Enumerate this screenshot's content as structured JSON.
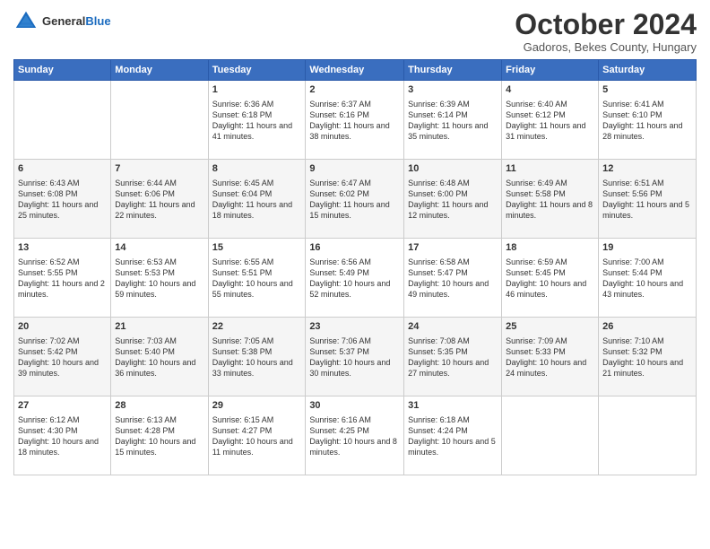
{
  "header": {
    "logo_general": "General",
    "logo_blue": "Blue",
    "month": "October 2024",
    "location": "Gadoros, Bekes County, Hungary"
  },
  "days_of_week": [
    "Sunday",
    "Monday",
    "Tuesday",
    "Wednesday",
    "Thursday",
    "Friday",
    "Saturday"
  ],
  "weeks": [
    [
      {
        "day": "",
        "info": ""
      },
      {
        "day": "",
        "info": ""
      },
      {
        "day": "1",
        "info": "Sunrise: 6:36 AM\nSunset: 6:18 PM\nDaylight: 11 hours and 41 minutes."
      },
      {
        "day": "2",
        "info": "Sunrise: 6:37 AM\nSunset: 6:16 PM\nDaylight: 11 hours and 38 minutes."
      },
      {
        "day": "3",
        "info": "Sunrise: 6:39 AM\nSunset: 6:14 PM\nDaylight: 11 hours and 35 minutes."
      },
      {
        "day": "4",
        "info": "Sunrise: 6:40 AM\nSunset: 6:12 PM\nDaylight: 11 hours and 31 minutes."
      },
      {
        "day": "5",
        "info": "Sunrise: 6:41 AM\nSunset: 6:10 PM\nDaylight: 11 hours and 28 minutes."
      }
    ],
    [
      {
        "day": "6",
        "info": "Sunrise: 6:43 AM\nSunset: 6:08 PM\nDaylight: 11 hours and 25 minutes."
      },
      {
        "day": "7",
        "info": "Sunrise: 6:44 AM\nSunset: 6:06 PM\nDaylight: 11 hours and 22 minutes."
      },
      {
        "day": "8",
        "info": "Sunrise: 6:45 AM\nSunset: 6:04 PM\nDaylight: 11 hours and 18 minutes."
      },
      {
        "day": "9",
        "info": "Sunrise: 6:47 AM\nSunset: 6:02 PM\nDaylight: 11 hours and 15 minutes."
      },
      {
        "day": "10",
        "info": "Sunrise: 6:48 AM\nSunset: 6:00 PM\nDaylight: 11 hours and 12 minutes."
      },
      {
        "day": "11",
        "info": "Sunrise: 6:49 AM\nSunset: 5:58 PM\nDaylight: 11 hours and 8 minutes."
      },
      {
        "day": "12",
        "info": "Sunrise: 6:51 AM\nSunset: 5:56 PM\nDaylight: 11 hours and 5 minutes."
      }
    ],
    [
      {
        "day": "13",
        "info": "Sunrise: 6:52 AM\nSunset: 5:55 PM\nDaylight: 11 hours and 2 minutes."
      },
      {
        "day": "14",
        "info": "Sunrise: 6:53 AM\nSunset: 5:53 PM\nDaylight: 10 hours and 59 minutes."
      },
      {
        "day": "15",
        "info": "Sunrise: 6:55 AM\nSunset: 5:51 PM\nDaylight: 10 hours and 55 minutes."
      },
      {
        "day": "16",
        "info": "Sunrise: 6:56 AM\nSunset: 5:49 PM\nDaylight: 10 hours and 52 minutes."
      },
      {
        "day": "17",
        "info": "Sunrise: 6:58 AM\nSunset: 5:47 PM\nDaylight: 10 hours and 49 minutes."
      },
      {
        "day": "18",
        "info": "Sunrise: 6:59 AM\nSunset: 5:45 PM\nDaylight: 10 hours and 46 minutes."
      },
      {
        "day": "19",
        "info": "Sunrise: 7:00 AM\nSunset: 5:44 PM\nDaylight: 10 hours and 43 minutes."
      }
    ],
    [
      {
        "day": "20",
        "info": "Sunrise: 7:02 AM\nSunset: 5:42 PM\nDaylight: 10 hours and 39 minutes."
      },
      {
        "day": "21",
        "info": "Sunrise: 7:03 AM\nSunset: 5:40 PM\nDaylight: 10 hours and 36 minutes."
      },
      {
        "day": "22",
        "info": "Sunrise: 7:05 AM\nSunset: 5:38 PM\nDaylight: 10 hours and 33 minutes."
      },
      {
        "day": "23",
        "info": "Sunrise: 7:06 AM\nSunset: 5:37 PM\nDaylight: 10 hours and 30 minutes."
      },
      {
        "day": "24",
        "info": "Sunrise: 7:08 AM\nSunset: 5:35 PM\nDaylight: 10 hours and 27 minutes."
      },
      {
        "day": "25",
        "info": "Sunrise: 7:09 AM\nSunset: 5:33 PM\nDaylight: 10 hours and 24 minutes."
      },
      {
        "day": "26",
        "info": "Sunrise: 7:10 AM\nSunset: 5:32 PM\nDaylight: 10 hours and 21 minutes."
      }
    ],
    [
      {
        "day": "27",
        "info": "Sunrise: 6:12 AM\nSunset: 4:30 PM\nDaylight: 10 hours and 18 minutes."
      },
      {
        "day": "28",
        "info": "Sunrise: 6:13 AM\nSunset: 4:28 PM\nDaylight: 10 hours and 15 minutes."
      },
      {
        "day": "29",
        "info": "Sunrise: 6:15 AM\nSunset: 4:27 PM\nDaylight: 10 hours and 11 minutes."
      },
      {
        "day": "30",
        "info": "Sunrise: 6:16 AM\nSunset: 4:25 PM\nDaylight: 10 hours and 8 minutes."
      },
      {
        "day": "31",
        "info": "Sunrise: 6:18 AM\nSunset: 4:24 PM\nDaylight: 10 hours and 5 minutes."
      },
      {
        "day": "",
        "info": ""
      },
      {
        "day": "",
        "info": ""
      }
    ]
  ]
}
